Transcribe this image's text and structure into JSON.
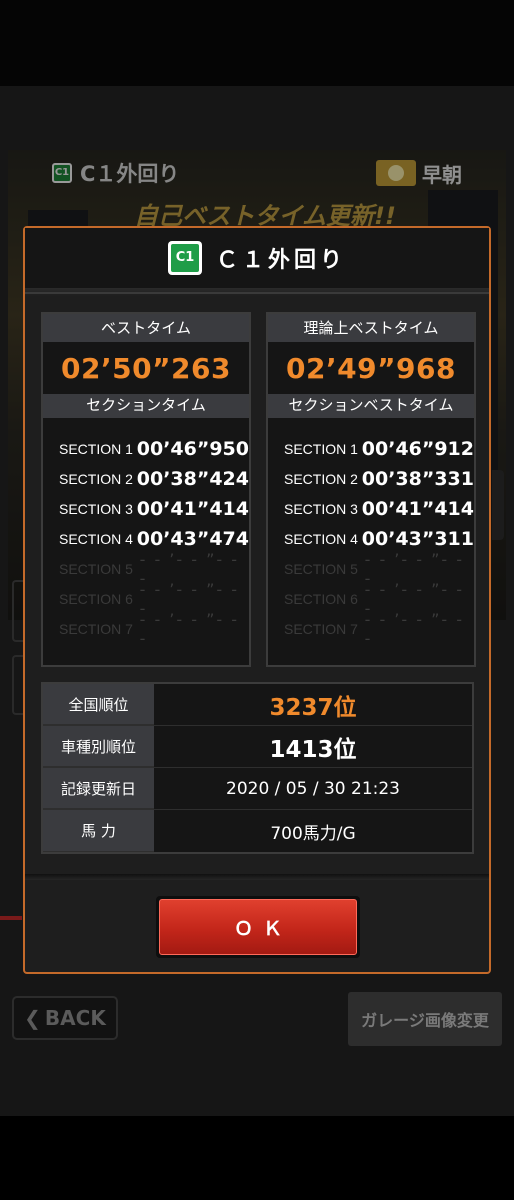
{
  "header": {
    "course_icon": "C1",
    "course_name": "Ｃ１外回り"
  },
  "background": {
    "course_name": "C１外回り",
    "time_of_day": "早朝",
    "banner": "自己ベストタイム更新!!",
    "back_label": "BACK",
    "garage_label": "ガレージ画像変更"
  },
  "best_panel": {
    "title": "ベストタイム",
    "time": "02’50”263",
    "section_title": "セクションタイム",
    "sections": [
      {
        "name": "SECTION 1",
        "time": "00’46”950"
      },
      {
        "name": "SECTION 2",
        "time": "00’38”424"
      },
      {
        "name": "SECTION 3",
        "time": "00’41”414"
      },
      {
        "name": "SECTION 4",
        "time": "00’43”474"
      },
      {
        "name": "SECTION 5",
        "time": "- - ’- - ”- - -"
      },
      {
        "name": "SECTION 6",
        "time": "- - ’- - ”- - -"
      },
      {
        "name": "SECTION 7",
        "time": "- - ’- - ”- - -"
      }
    ]
  },
  "theory_panel": {
    "title": "理論上ベストタイム",
    "time": "02’49”968",
    "section_title": "セクションベストタイム",
    "sections": [
      {
        "name": "SECTION 1",
        "time": "00’46”912"
      },
      {
        "name": "SECTION 2",
        "time": "00’38”331"
      },
      {
        "name": "SECTION 3",
        "time": "00’41”414"
      },
      {
        "name": "SECTION 4",
        "time": "00’43”311"
      },
      {
        "name": "SECTION 5",
        "time": "- - ’- - ”- - -"
      },
      {
        "name": "SECTION 6",
        "time": "- - ’- - ”- - -"
      },
      {
        "name": "SECTION 7",
        "time": "- - ’- - ”- - -"
      }
    ]
  },
  "stats": [
    {
      "label": "全国順位",
      "value": "3237位"
    },
    {
      "label": "車種別順位",
      "value": "1413位"
    },
    {
      "label": "記録更新日",
      "value": "2020 / 05 / 30 21:23"
    },
    {
      "label": "馬 力",
      "value": "700馬力/G"
    }
  ],
  "ok_label": "ＯＫ",
  "colors": {
    "accent": "#f08a2c",
    "ok_red": "#c3261a",
    "border": "#c46a2a"
  }
}
